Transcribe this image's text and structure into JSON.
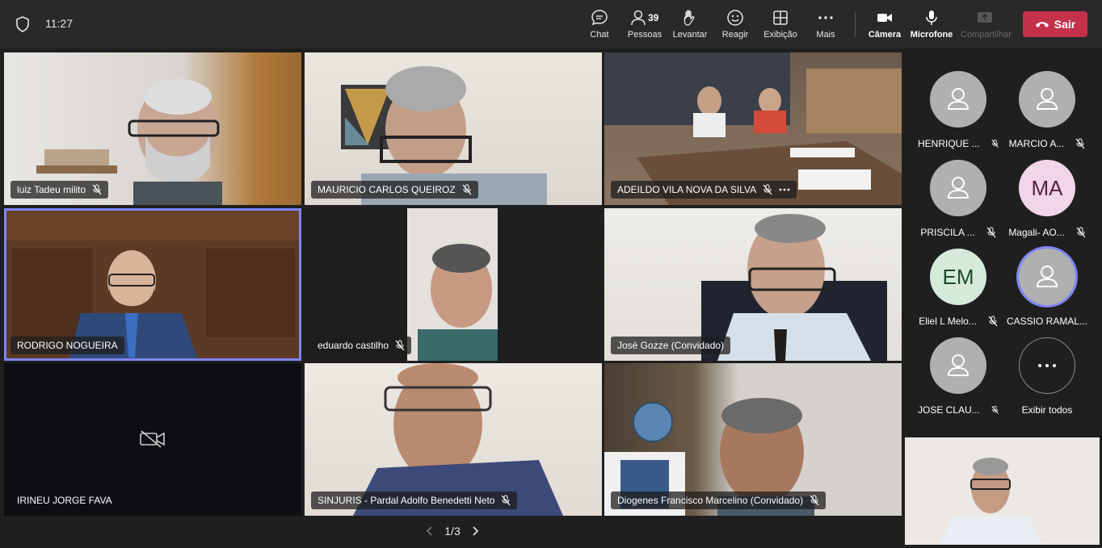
{
  "status": {
    "time": "11:27",
    "security_icon": "shield-icon"
  },
  "toolbar": {
    "chat": "Chat",
    "people": "Pessoas",
    "people_count": "39",
    "raise": "Levantar",
    "react": "Reagir",
    "view": "Exibição",
    "more": "Mais",
    "camera": "Câmera",
    "mic": "Microfone",
    "share": "Compartilhar",
    "leave": "Sair",
    "leave_color": "#c4314b"
  },
  "grid": {
    "tiles": [
      {
        "name": "luiz Tadeu milito",
        "muted": true
      },
      {
        "name": "MAURICIO CARLOS QUEIROZ",
        "muted": true
      },
      {
        "name": "ADEILDO VILA NOVA DA SILVA",
        "muted": true
      },
      {
        "name": "RODRIGO NOGUEIRA",
        "muted": false
      },
      {
        "name": "eduardo castilho",
        "muted": true
      },
      {
        "name": "José Gozze (Convidado)",
        "muted": false
      },
      {
        "name": "IRINEU JORGE FAVA",
        "muted": false,
        "camera_off": true
      },
      {
        "name": "SINJURIS - Pardal Adolfo Benedetti Neto",
        "muted": true
      },
      {
        "name": "Diogenes Francisco Marcelino (Convidado)",
        "muted": true
      }
    ]
  },
  "sidebar": {
    "people": [
      {
        "name": "HENRIQUE ...",
        "muted": true
      },
      {
        "name": "MARCIO A...",
        "muted": true
      },
      {
        "name": "PRISCILA ...",
        "muted": true
      },
      {
        "name": "Magali- AO...",
        "initials": "MA",
        "muted": true
      },
      {
        "name": "Eliel L Melo...",
        "initials": "EM",
        "muted": true
      },
      {
        "name": "CASSIO RAMAL...",
        "muted": false
      },
      {
        "name": "JOSE CLAU...",
        "muted": true
      }
    ],
    "show_all": "Exibir todos"
  },
  "pager": {
    "label": "1/3"
  },
  "accent": "#7f85f5"
}
